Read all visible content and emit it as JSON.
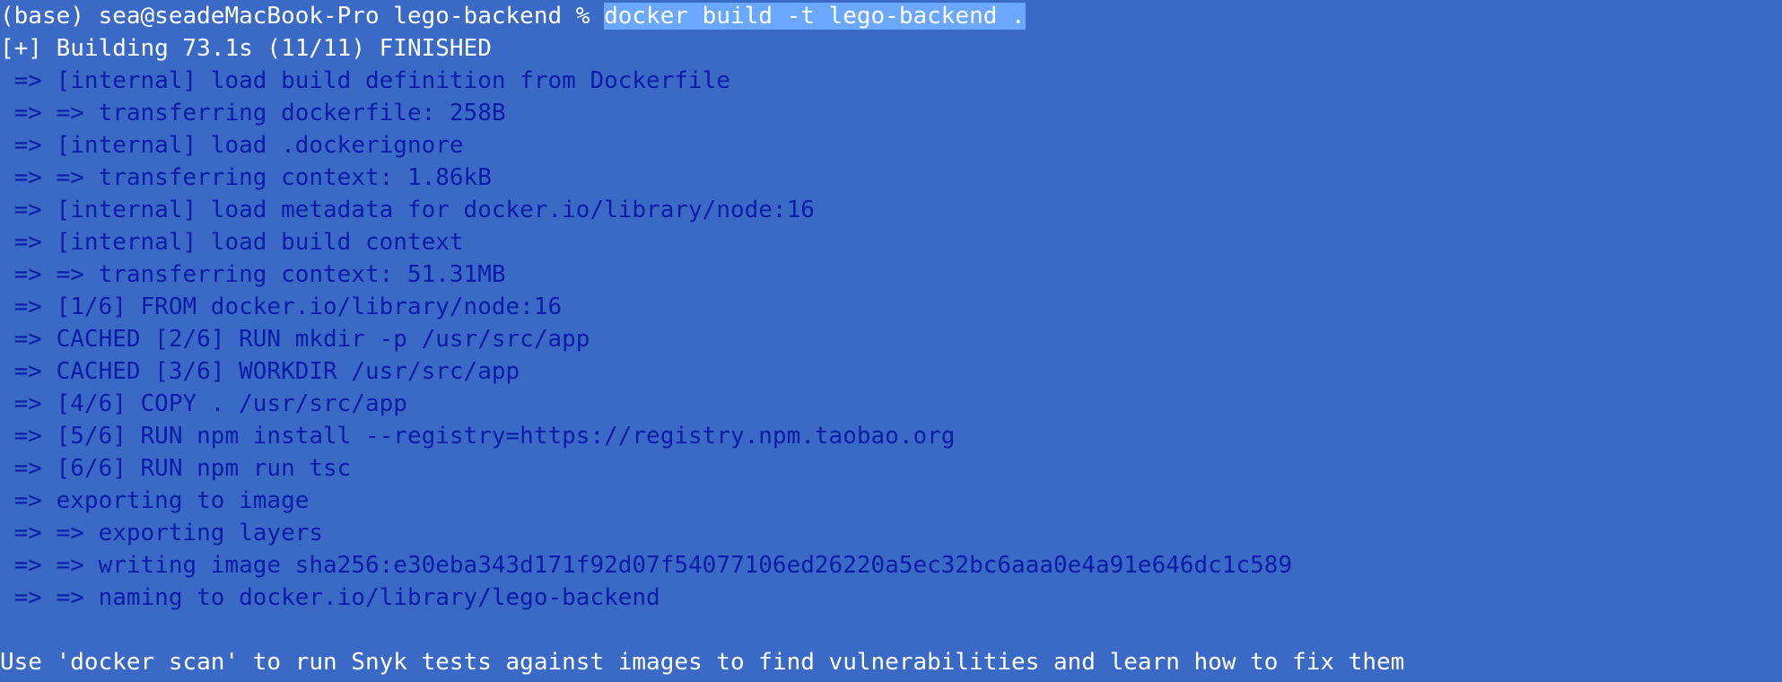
{
  "terminal": {
    "prompt": "(base) sea@seadeMacBook-Pro lego-backend % ",
    "command": "docker build -t lego-backend .",
    "status": "[+] Building 73.1s (11/11) FINISHED",
    "steps": [
      " => [internal] load build definition from Dockerfile",
      " => => transferring dockerfile: 258B",
      " => [internal] load .dockerignore",
      " => => transferring context: 1.86kB",
      " => [internal] load metadata for docker.io/library/node:16",
      " => [internal] load build context",
      " => => transferring context: 51.31MB",
      " => [1/6] FROM docker.io/library/node:16",
      " => CACHED [2/6] RUN mkdir -p /usr/src/app",
      " => CACHED [3/6] WORKDIR /usr/src/app",
      " => [4/6] COPY . /usr/src/app",
      " => [5/6] RUN npm install --registry=https://registry.npm.taobao.org",
      " => [6/6] RUN npm run tsc",
      " => exporting to image",
      " => => exporting layers",
      " => => writing image sha256:e30eba343d171f92d07f54077106ed26220a5ec32bc6aaa0e4a91e646dc1c589",
      " => => naming to docker.io/library/lego-backend"
    ],
    "footer": "Use 'docker scan' to run Snyk tests against images to find vulnerabilities and learn how to fix them"
  }
}
